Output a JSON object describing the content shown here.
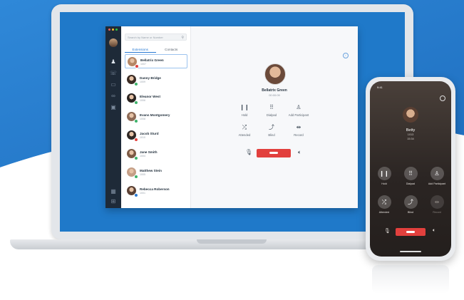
{
  "colors": {
    "accent": "#2a7bd3",
    "hangup": "#e2403d",
    "rail": "#1e2a38",
    "screen_blue": "#1f79c9"
  },
  "desktop": {
    "search": {
      "placeholder": "Search by Name or Number",
      "icon": "search-icon"
    },
    "tabs": [
      {
        "label": "Extensions",
        "active": true
      },
      {
        "label": "Contacts",
        "active": false
      }
    ],
    "contacts": [
      {
        "name": "Bellatrix Green",
        "ext": "1007",
        "status": "#e2403d",
        "avatar": "#b58766",
        "selected": true
      },
      {
        "name": "Danny Bridge",
        "ext": "1009",
        "status": "#3db36b",
        "avatar": "#3b2c24",
        "selected": false
      },
      {
        "name": "Eleanor West",
        "ext": "1006",
        "status": "#3db36b",
        "avatar": "#2a2320",
        "selected": false
      },
      {
        "name": "Evans Montgomery",
        "ext": "1008",
        "status": "#3db36b",
        "avatar": "#8d6a56",
        "selected": false
      },
      {
        "name": "Jacob Sturd",
        "ext": "1010",
        "status": "#e2403d",
        "avatar": "#2e2724",
        "selected": false
      },
      {
        "name": "Jane Smith",
        "ext": "1004",
        "status": "#3db36b",
        "avatar": "#7c5a45",
        "selected": false
      },
      {
        "name": "Matthew Stein",
        "ext": "1005",
        "status": "#3db36b",
        "avatar": "#c49e86",
        "selected": false
      },
      {
        "name": "Rebecca Roberson",
        "ext": "1001",
        "status": "#2a7bd3",
        "avatar": "#5a4034",
        "selected": false
      }
    ],
    "call": {
      "name": "Bellatrix Green",
      "timer": "00:00:09",
      "controls": [
        {
          "label": "Hold",
          "icon": "pause-icon",
          "glyph": "❙❙"
        },
        {
          "label": "Dialpad",
          "icon": "dialpad-icon",
          "glyph": "⠿"
        },
        {
          "label": "Add Participant",
          "icon": "add-participant-icon",
          "glyph": "♙"
        },
        {
          "label": "Attended",
          "icon": "attended-transfer-icon",
          "glyph": "⤮"
        },
        {
          "label": "Blind",
          "icon": "blind-transfer-icon",
          "glyph": "⤴"
        },
        {
          "label": "Record",
          "icon": "record-icon",
          "glyph": "⇹"
        }
      ]
    }
  },
  "phone": {
    "status_time": "9:41",
    "name": "Betty",
    "ext": "1013",
    "timer": "15:34",
    "controls": [
      {
        "label": "Hold",
        "icon": "pause-icon",
        "glyph": "❙❙",
        "enabled": true
      },
      {
        "label": "Dialpad",
        "icon": "dialpad-icon",
        "glyph": "⠿",
        "enabled": true
      },
      {
        "label": "Add Participant",
        "icon": "add-participant-icon",
        "glyph": "♙",
        "enabled": true
      },
      {
        "label": "Attended",
        "icon": "attended-transfer-icon",
        "glyph": "⤮",
        "enabled": true
      },
      {
        "label": "Blind",
        "icon": "blind-transfer-icon",
        "glyph": "⤴",
        "enabled": true
      },
      {
        "label": "Record",
        "icon": "record-icon",
        "glyph": "⇹",
        "enabled": false
      }
    ]
  }
}
